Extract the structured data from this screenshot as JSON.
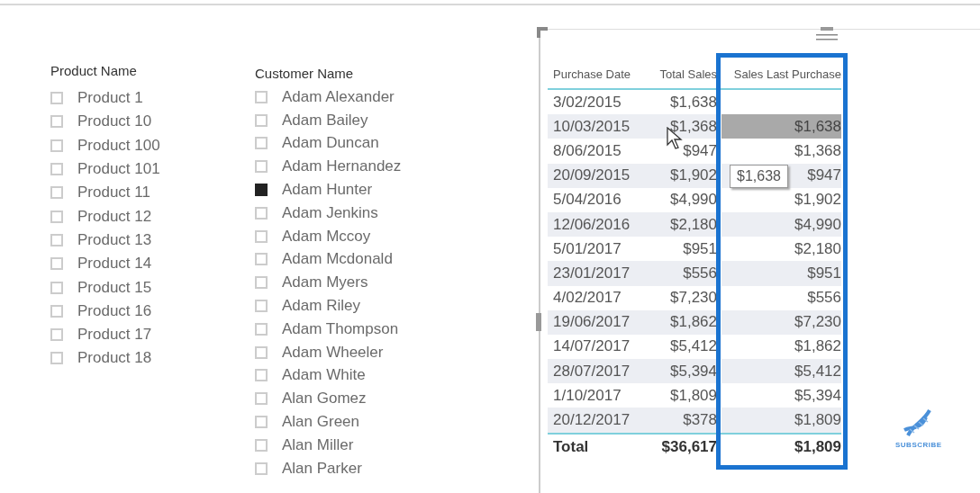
{
  "product_slicer": {
    "title": "Product Name",
    "items": [
      {
        "label": "Product 1",
        "checked": false
      },
      {
        "label": "Product 10",
        "checked": false
      },
      {
        "label": "Product 100",
        "checked": false
      },
      {
        "label": "Product 101",
        "checked": false
      },
      {
        "label": "Product 11",
        "checked": false
      },
      {
        "label": "Product 12",
        "checked": false
      },
      {
        "label": "Product 13",
        "checked": false
      },
      {
        "label": "Product 14",
        "checked": false
      },
      {
        "label": "Product 15",
        "checked": false
      },
      {
        "label": "Product 16",
        "checked": false
      },
      {
        "label": "Product 17",
        "checked": false
      },
      {
        "label": "Product 18",
        "checked": false
      }
    ]
  },
  "customer_slicer": {
    "title": "Customer Name",
    "items": [
      {
        "label": "Adam Alexander",
        "checked": false
      },
      {
        "label": "Adam Bailey",
        "checked": false
      },
      {
        "label": "Adam Duncan",
        "checked": false
      },
      {
        "label": "Adam Hernandez",
        "checked": false
      },
      {
        "label": "Adam Hunter",
        "checked": true
      },
      {
        "label": "Adam Jenkins",
        "checked": false
      },
      {
        "label": "Adam Mccoy",
        "checked": false
      },
      {
        "label": "Adam Mcdonald",
        "checked": false
      },
      {
        "label": "Adam Myers",
        "checked": false
      },
      {
        "label": "Adam Riley",
        "checked": false
      },
      {
        "label": "Adam Thompson",
        "checked": false
      },
      {
        "label": "Adam Wheeler",
        "checked": false
      },
      {
        "label": "Adam White",
        "checked": false
      },
      {
        "label": "Alan Gomez",
        "checked": false
      },
      {
        "label": "Alan Green",
        "checked": false
      },
      {
        "label": "Alan Miller",
        "checked": false
      },
      {
        "label": "Alan Parker",
        "checked": false
      }
    ]
  },
  "table": {
    "columns": [
      {
        "label": "Purchase Date",
        "highlighted": false
      },
      {
        "label": "Total Sales",
        "highlighted": false
      },
      {
        "label": "Sales Last Purchase",
        "highlighted": true
      }
    ],
    "rows": [
      {
        "date": "3/02/2015",
        "total": "$1,638",
        "selected": false
      },
      {
        "date": "10/03/2015",
        "total": "$1,368",
        "last": "$1,638",
        "selected": true
      },
      {
        "date": "8/06/2015",
        "total": "$947",
        "last": "$1,368",
        "selected": false
      },
      {
        "date": "20/09/2015",
        "total": "$1,902",
        "last": "$947",
        "selected": false
      },
      {
        "date": "5/04/2016",
        "total": "$4,990",
        "last": "$1,902",
        "selected": false
      },
      {
        "date": "12/06/2016",
        "total": "$2,180",
        "last": "$4,990",
        "selected": false
      },
      {
        "date": "5/01/2017",
        "total": "$951",
        "last": "$2,180",
        "selected": false
      },
      {
        "date": "23/01/2017",
        "total": "$556",
        "last": "$951",
        "selected": false
      },
      {
        "date": "4/02/2017",
        "total": "$7,230",
        "last": "$556",
        "selected": false
      },
      {
        "date": "19/06/2017",
        "total": "$1,862",
        "last": "$7,230",
        "selected": false
      },
      {
        "date": "14/07/2017",
        "total": "$5,412",
        "last": "$1,862",
        "selected": false
      },
      {
        "date": "28/07/2017",
        "total": "$5,394",
        "last": "$5,412",
        "selected": false
      },
      {
        "date": "1/10/2017",
        "total": "$1,809",
        "last": "$5,394",
        "selected": false
      },
      {
        "date": "20/12/2017",
        "total": "$378",
        "last": "$1,809",
        "selected": false
      }
    ],
    "total_row": {
      "label": "Total",
      "total": "$36,617",
      "last": "$1,809"
    },
    "tooltip": "$1,638"
  },
  "subscribe": {
    "label": "SUBSCRIBE"
  }
}
